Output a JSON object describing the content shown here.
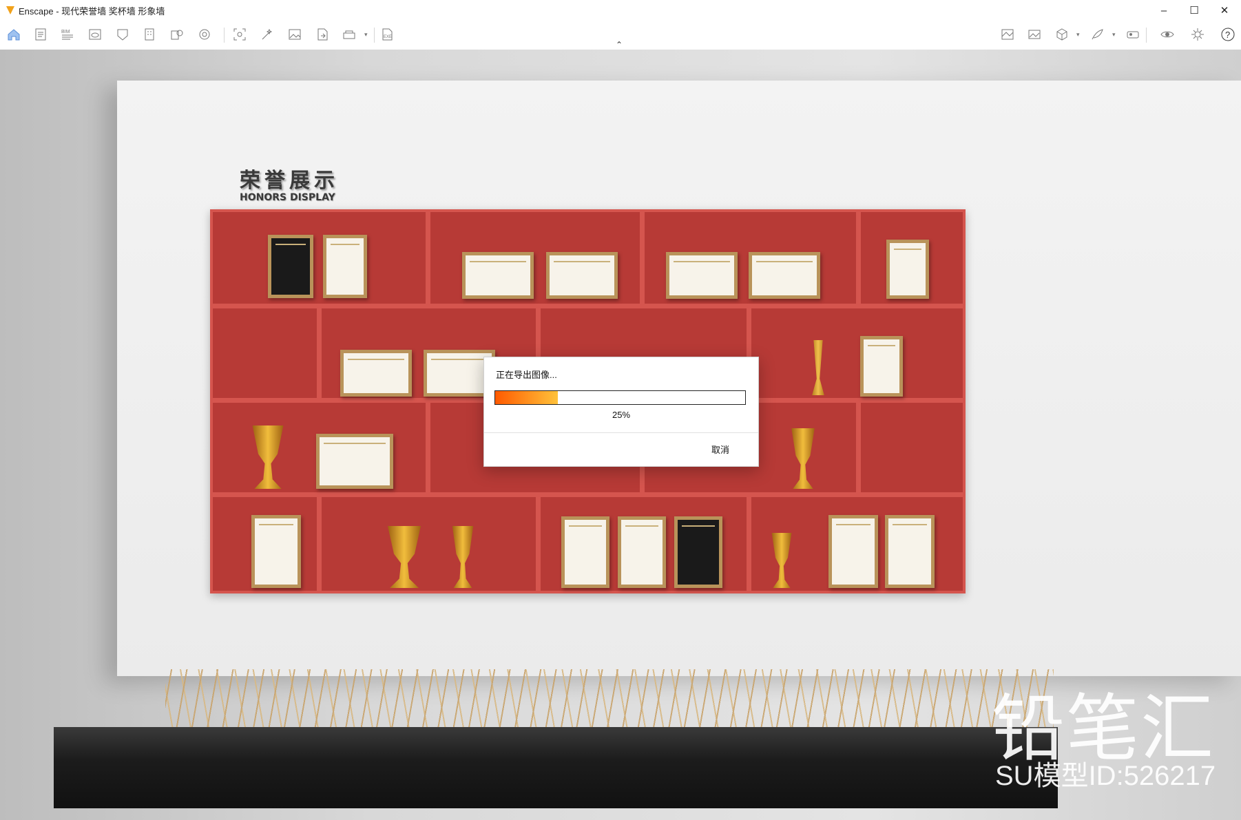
{
  "window": {
    "title": "Enscape - 现代荣誉墙 奖杯墙 形象墙",
    "minimize": "–",
    "maximize": "☐",
    "close": "✕"
  },
  "toolbar": {
    "left_icons": [
      "home-icon",
      "document-icon",
      "bim-icon",
      "visual-settings-icon",
      "asset-library-icon",
      "building-icon",
      "export-icon",
      "material-icon",
      "screenshot-icon",
      "magic-icon",
      "image-icon",
      "file-export-icon",
      "batch-render-icon",
      "exe-export-icon"
    ],
    "right_icons": [
      "map-icon",
      "gallery-icon",
      "cube-icon",
      "feather-icon",
      "vr-icon",
      "eye-icon",
      "settings-icon",
      "help-icon"
    ],
    "collapse": "⌃"
  },
  "scene": {
    "sign_cn": "荣誉展示",
    "sign_en": "HONORS DISPLAY",
    "watermark_brand": "铅笔汇",
    "watermark_id": "SU模型ID:526217"
  },
  "dialog": {
    "title": "正在导出图像...",
    "progress": 0.25,
    "percent_text": "25%",
    "cancel_label": "取消"
  },
  "colors": {
    "progress_start": "#ff5a00",
    "progress_end": "#ffc23a",
    "shelf_red": "#b73a36",
    "app_accent": "#f1a21b"
  }
}
